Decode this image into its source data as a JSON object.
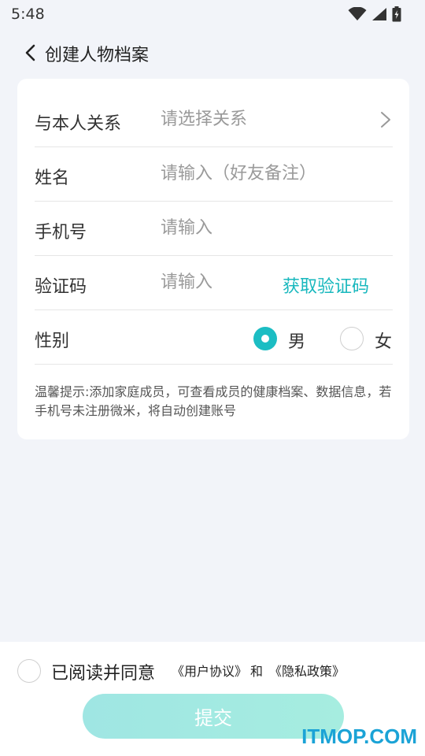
{
  "status_bar": {
    "time": "5:48",
    "icons": [
      "wifi-icon",
      "signal-icon",
      "battery-icon"
    ]
  },
  "header": {
    "title": "创建人物档案",
    "back_icon": "chevron-left-icon"
  },
  "form": {
    "relation": {
      "label": "与本人关系",
      "placeholder": "请选择关系"
    },
    "name": {
      "label": "姓名",
      "placeholder": "请输入（好友备注）"
    },
    "phone": {
      "label": "手机号",
      "placeholder": "请输入"
    },
    "code": {
      "label": "验证码",
      "placeholder": "请输入",
      "action": "获取验证码"
    },
    "gender": {
      "label": "性别",
      "options": [
        "男",
        "女"
      ],
      "selected": "男"
    },
    "tip": "温馨提示:添加家庭成员，可查看成员的健康档案、数据信息，若手机号未注册微米，将自动创建账号"
  },
  "agreement": {
    "text": "已阅读并同意",
    "user_agreement": "《用户协议》",
    "and": "和",
    "privacy_policy": "《隐私政策》"
  },
  "submit": {
    "label": "提交"
  },
  "watermark": "ITMOP.COM",
  "colors": {
    "accent": "#1cbdc3",
    "link": "#19b8be",
    "background": "#f2f4f9",
    "button_gradient_start": "#9fe6e3",
    "button_gradient_end": "#a6ede0"
  }
}
